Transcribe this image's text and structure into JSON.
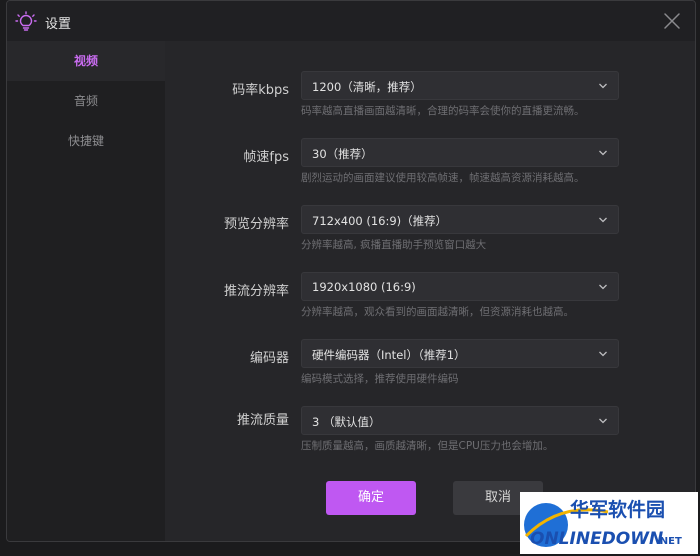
{
  "window": {
    "title": "设置"
  },
  "sidebar": {
    "items": [
      {
        "label": "视频",
        "active": true
      },
      {
        "label": "音频",
        "active": false
      },
      {
        "label": "快捷键",
        "active": false
      }
    ]
  },
  "settings": [
    {
      "label": "码率kbps",
      "value": "1200（清晰，推荐）",
      "hint": "码率越高直播画面越清晰，合理的码率会使你的直播更流畅。"
    },
    {
      "label": "帧速fps",
      "value": "30（推荐）",
      "hint": "剧烈运动的画面建议使用较高帧速，帧速越高资源消耗越高。"
    },
    {
      "label": "预览分辨率",
      "value": "712x400 (16:9)（推荐）",
      "hint": "分辨率越高, 疯播直播助手预览窗口越大"
    },
    {
      "label": "推流分辨率",
      "value": "1920x1080 (16:9)",
      "hint": "分辨率越高，观众看到的画面越清晰，但资源消耗也越高。"
    },
    {
      "label": "编码器",
      "value": "硬件编码器（Intel）（推荐1）",
      "hint": "编码模式选择，推荐使用硬件编码"
    },
    {
      "label": "推流质量",
      "value": "3 （默认值）",
      "hint": "压制质量越高，画质越清晰，但是CPU压力也会增加。"
    }
  ],
  "buttons": {
    "confirm": "确定",
    "cancel": "取消"
  },
  "watermark": {
    "line1": "华军软件园",
    "line2": "ONLINEDOWN",
    "suffix": ".NET"
  },
  "colors": {
    "accent": "#bf58f2",
    "background": "#262629",
    "sidebar": "#1f1f21"
  },
  "icons": {
    "app": "lightbulb-icon",
    "close": "close-icon",
    "dropdown": "chevron-down-icon"
  }
}
